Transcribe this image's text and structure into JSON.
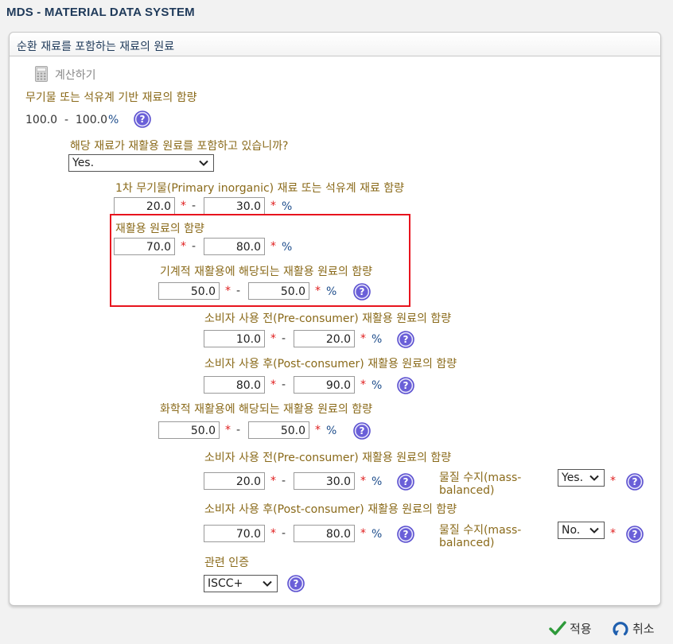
{
  "app": {
    "title": "MDS - MATERIAL DATA SYSTEM"
  },
  "panel": {
    "title": "순환 재료를 포함하는 재료의 원료",
    "calc_label": "계산하기"
  },
  "inorganic": {
    "label": "무기물 또는 석유계 기반 재료의 함량",
    "range_text": "100.0  -  100.0",
    "unit": "%"
  },
  "contains_recycled": {
    "question": "해당 재료가 재활용 원료를 포함하고 있습니까?",
    "value": "Yes."
  },
  "primary": {
    "label": "1차 무기물(Primary inorganic) 재료 또는 석유계 재료 함량",
    "min": "20.0",
    "max": "30.0",
    "unit": "%"
  },
  "recycled": {
    "label": "재활용 원료의 함량",
    "min": "70.0",
    "max": "80.0",
    "unit": "%"
  },
  "mechanical": {
    "label": "기계적 재활용에 해당되는 재활용 원료의 함량",
    "min": "50.0",
    "max": "50.0",
    "unit": "%",
    "pre": {
      "label": "소비자 사용 전(Pre-consumer) 재활용 원료의 함량",
      "min": "10.0",
      "max": "20.0",
      "unit": "%"
    },
    "post": {
      "label": "소비자 사용 후(Post-consumer) 재활용 원료의 함량",
      "min": "80.0",
      "max": "90.0",
      "unit": "%"
    }
  },
  "chemical": {
    "label": "화학적 재활용에 해당되는 재활용 원료의 함량",
    "min": "50.0",
    "max": "50.0",
    "unit": "%",
    "pre": {
      "label": "소비자 사용 전(Pre-consumer) 재활용 원료의 함량",
      "min": "20.0",
      "max": "30.0",
      "unit": "%",
      "mass_label_1": "물질 수지(mass-",
      "mass_label_2": "balanced)",
      "mass_value": "Yes."
    },
    "post": {
      "label": "소비자 사용 후(Post-consumer) 재활용 원료의 함량",
      "min": "70.0",
      "max": "80.0",
      "unit": "%",
      "mass_label_1": "물질 수지(mass-",
      "mass_label_2": "balanced)",
      "mass_value": "No."
    },
    "cert_label": "관련 인증",
    "cert_value": "ISCC+"
  },
  "symbols": {
    "star": "*",
    "dash": "-"
  },
  "footer": {
    "apply_label": "적용",
    "cancel_label": "취소"
  },
  "colors": {
    "label": "#8a6a1a",
    "accent": "#1f3a5a",
    "required": "#e02020",
    "highlight": "#e8141e",
    "help": "#5a4fcf",
    "apply_check": "#2e9a3a"
  },
  "icons": {
    "calc": "calculator-icon",
    "help": "help-icon",
    "apply": "checkmark-icon",
    "cancel": "undo-icon",
    "dropdown": "chevron-down-icon"
  }
}
